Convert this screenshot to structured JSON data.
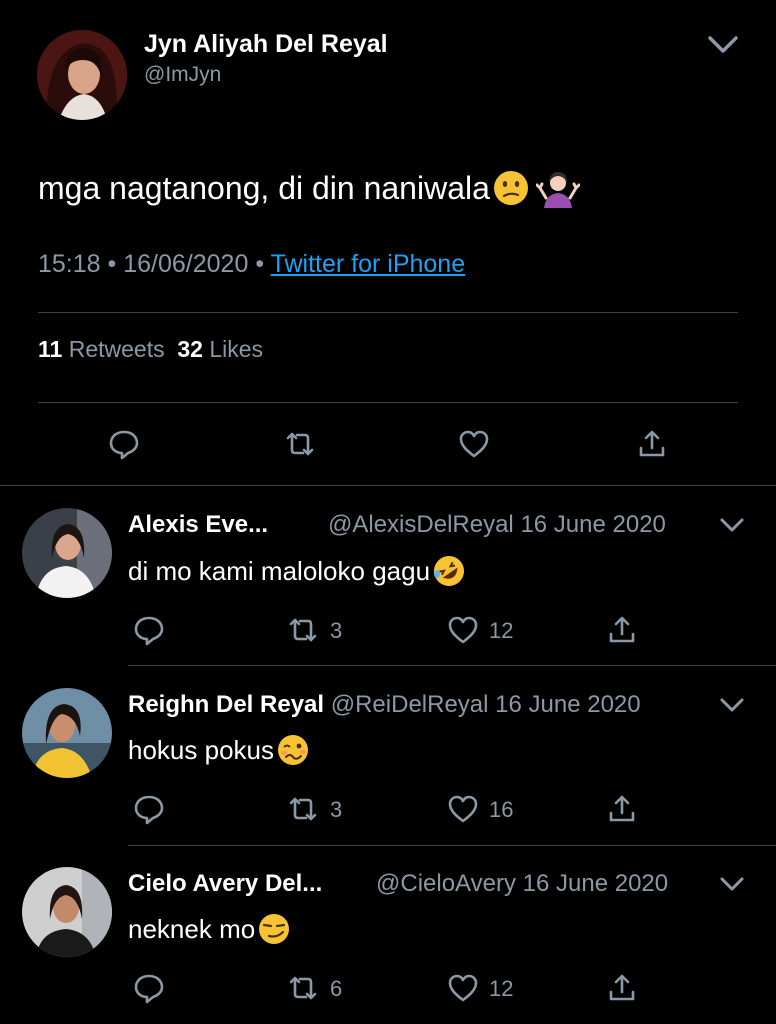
{
  "tweet": {
    "author_name": "Jyn Aliyah Del Reyal",
    "author_handle": "@ImJyn",
    "text": "mga nagtanong, di din naniwala",
    "emojis": [
      "confused-face",
      "person-shrugging"
    ],
    "time": "15:18",
    "date": "16/06/2020",
    "separator": "•",
    "source": "Twitter for iPhone",
    "retweet_count": "11",
    "retweet_label": "Retweets",
    "like_count": "32",
    "like_label": "Likes"
  },
  "replies": [
    {
      "name": "Alexis Eve...",
      "handle": "@AlexisDelReyal",
      "date": "16 June 2020",
      "text": "di mo kami maloloko gagu",
      "emoji": "rolling-on-floor-laughing",
      "retweets": "3",
      "likes": "12"
    },
    {
      "name": "Reighn Del Reyal",
      "handle": "@ReiDelReyal",
      "date": "16 June 2020",
      "text": "hokus pokus",
      "emoji": "woozy-face",
      "retweets": "3",
      "likes": "16"
    },
    {
      "name": "Cielo Avery Del...",
      "handle": "@CieloAvery",
      "date": "16 June 2020",
      "text": "neknek mo",
      "emoji": "smirking-face",
      "retweets": "6",
      "likes": "12"
    }
  ],
  "colors": {
    "background": "#000000",
    "text": "#ffffff",
    "secondary": "#8b98a5",
    "link": "#1da1f2",
    "divider": "#38444d",
    "emoji_yellow": "#f7c334"
  }
}
